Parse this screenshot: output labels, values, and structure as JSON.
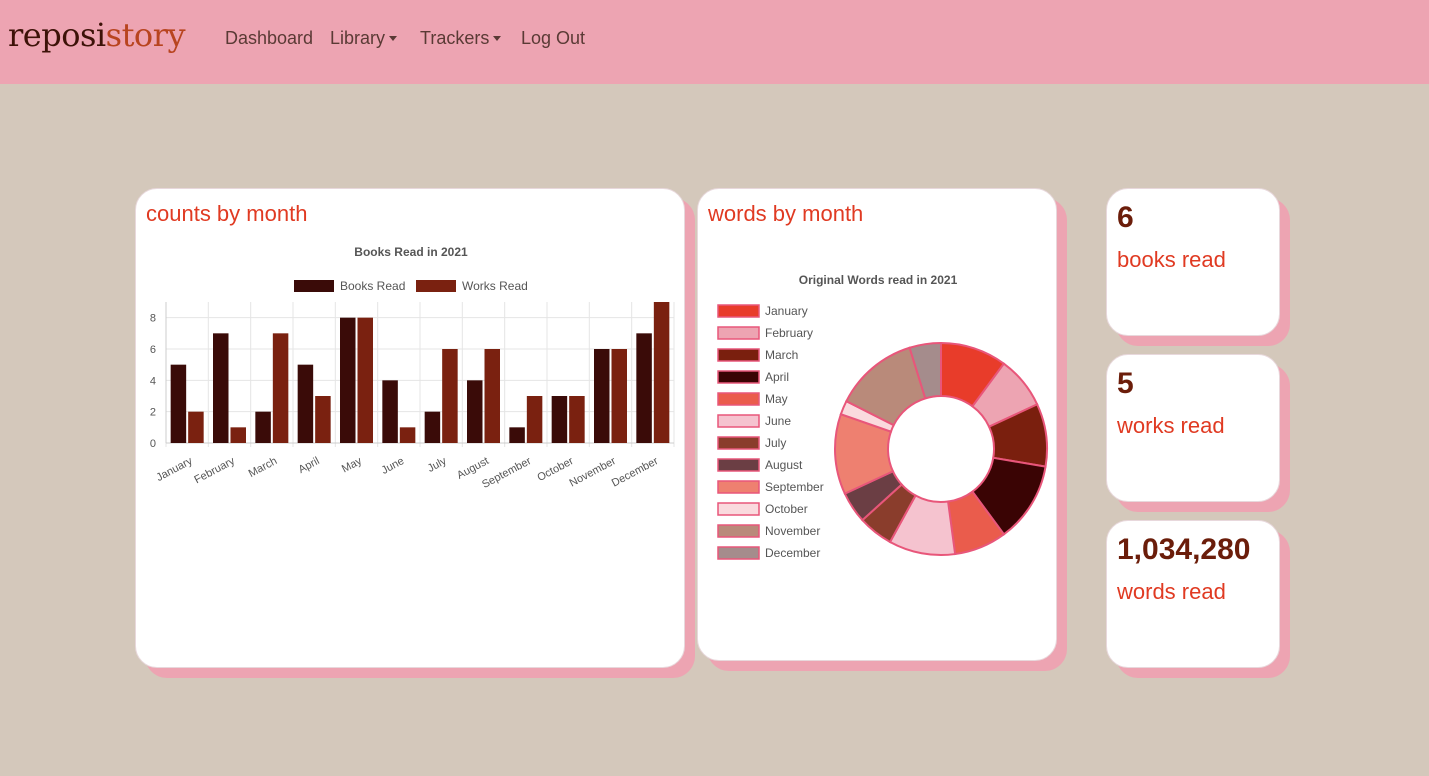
{
  "nav": {
    "brand_part1": "reposi",
    "brand_part2": "story",
    "dashboard": "Dashboard",
    "library": "Library",
    "trackers": "Trackers",
    "logout": "Log Out"
  },
  "colors": {
    "navbar": "#eda4b2",
    "background": "#d4c8bb",
    "title_red": "#e03a22",
    "stat_brown": "#6b1d0a"
  },
  "counts_card": {
    "title": "counts by month"
  },
  "words_card": {
    "title": "words by month"
  },
  "stats": [
    {
      "number": "6",
      "label": "books read"
    },
    {
      "number": "5",
      "label": "works read"
    },
    {
      "number": "1,034,280",
      "label": "words read"
    }
  ],
  "chart_data": [
    {
      "type": "bar",
      "title": "Books Read in 2021",
      "categories": [
        "January",
        "February",
        "March",
        "April",
        "May",
        "June",
        "July",
        "August",
        "September",
        "October",
        "November",
        "December"
      ],
      "series": [
        {
          "name": "Books Read",
          "color": "#3a0b08",
          "values": [
            5,
            7,
            2,
            5,
            8,
            4,
            2,
            4,
            1,
            3,
            6,
            7
          ]
        },
        {
          "name": "Works Read",
          "color": "#7a2110",
          "values": [
            2,
            1,
            7,
            3,
            8,
            1,
            6,
            6,
            3,
            3,
            6,
            9
          ]
        }
      ],
      "y_ticks": [
        0,
        2,
        4,
        6,
        8
      ],
      "ylim": [
        0,
        9
      ],
      "grid": true,
      "legend": "top"
    },
    {
      "type": "pie",
      "title": "Original Words read in 2021",
      "categories": [
        "January",
        "February",
        "March",
        "April",
        "May",
        "June",
        "July",
        "August",
        "September",
        "October",
        "November",
        "December"
      ],
      "values": [
        9.5,
        7.5,
        9,
        11.5,
        7.5,
        9.5,
        5,
        4.5,
        11.5,
        2,
        12,
        4.5
      ],
      "colors": [
        "#e83c2a",
        "#eda4b2",
        "#7a1f0e",
        "#3a0404",
        "#ea5c4c",
        "#f5c3cf",
        "#8a3d2c",
        "#6b3e44",
        "#ee8070",
        "#fadade",
        "#b98a7a",
        "#a58c8c"
      ],
      "legend": "left",
      "donut": true
    }
  ]
}
